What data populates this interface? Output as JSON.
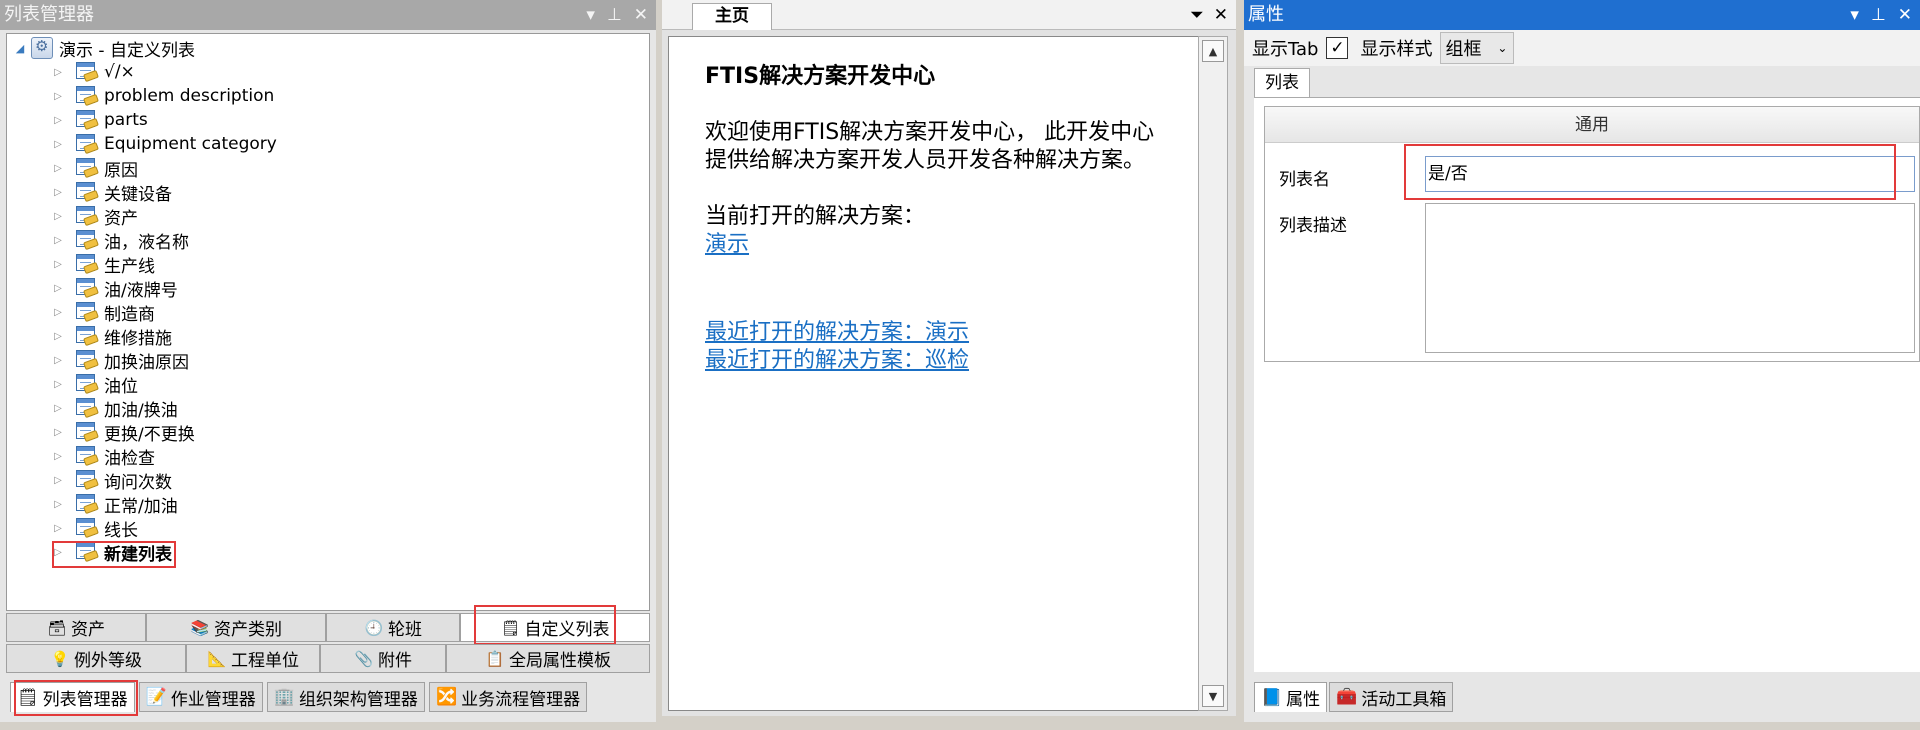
{
  "left_panel": {
    "title": "列表管理器",
    "controls": [
      "▾",
      "⊥",
      "✕"
    ],
    "root": "演示 - 自定义列表",
    "items": [
      "√/×",
      "problem description",
      "parts",
      "Equipment category",
      "原因",
      "关键设备",
      "资产",
      "油，液名称",
      "生产线",
      "油/液牌号",
      "制造商",
      "维修措施",
      "加换油原因",
      "油位",
      "加油/换油",
      "更换/不更换",
      "油检查",
      "询问次数",
      "正常/加油",
      "线长",
      "新建列表"
    ],
    "tabs_row1": [
      "资产",
      "资产类别",
      "轮班",
      "自定义列表"
    ],
    "tabs_row2": [
      "例外等级",
      "工程单位",
      "附件",
      "全局属性模板"
    ],
    "bottom_tabs": [
      "列表管理器",
      "作业管理器",
      "组织架构管理器",
      "业务流程管理器"
    ]
  },
  "middle_panel": {
    "tab": "主页",
    "controls": [
      "⏷",
      "✕"
    ],
    "heading": "FTIS解决方案开发中心",
    "intro_line1": "欢迎使用FTIS解决方案开发中心， 此开发中心",
    "intro_line2": "提供给解决方案开发人员开发各种解决方案。",
    "current_label": "当前打开的解决方案：",
    "current_link": "演示",
    "recent1": "最近打开的解决方案：演示",
    "recent2": "最近打开的解决方案：巡检"
  },
  "right_panel": {
    "title": "属性",
    "controls": [
      "▾",
      "⊥",
      "✕"
    ],
    "show_tab": "显示Tab",
    "show_style": "显示样式",
    "style_value": "组框",
    "tab": "列表",
    "group_header": "通用",
    "name_label": "列表名",
    "name_value": "是/否",
    "desc_label": "列表描述",
    "bottom_tabs": [
      "属性",
      "活动工具箱"
    ]
  },
  "colors": {
    "accent_title": "#1f6fd0",
    "highlight": "#e23a3a",
    "link": "#1a6fc4"
  }
}
